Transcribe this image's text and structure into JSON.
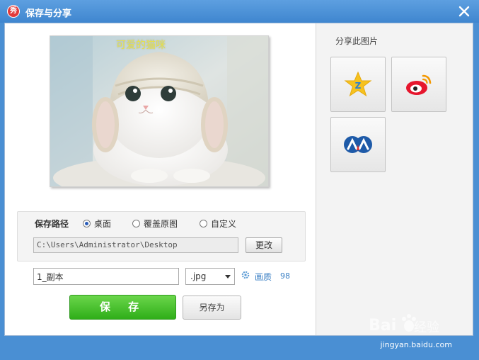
{
  "window": {
    "title": "保存与分享",
    "app_icon_text": "秀"
  },
  "preview": {
    "caption": "可爱的猫咪"
  },
  "share": {
    "title": "分享此图片",
    "buttons": [
      {
        "icon": "qzone-star-icon"
      },
      {
        "icon": "weibo-icon"
      },
      {
        "icon": "renren-icon"
      }
    ]
  },
  "save_path": {
    "label": "保存路径",
    "options": [
      "桌面",
      "覆盖原图",
      "自定义"
    ],
    "selected": "桌面",
    "path_value": "C:\\Users\\Administrator\\Desktop",
    "change_label": "更改"
  },
  "file": {
    "name": "1_副本",
    "format": ".jpg",
    "quality_label": "画质",
    "quality_value": "98"
  },
  "actions": {
    "save_label": "保 存",
    "save_as_label": "另存为"
  },
  "watermark": {
    "brand": "Baidu经验",
    "url": "jingyan.baidu.com"
  },
  "colors": {
    "title_bar": "#4a8fd3",
    "save_green": "#3cb526",
    "link_blue": "#3a7fc4"
  }
}
